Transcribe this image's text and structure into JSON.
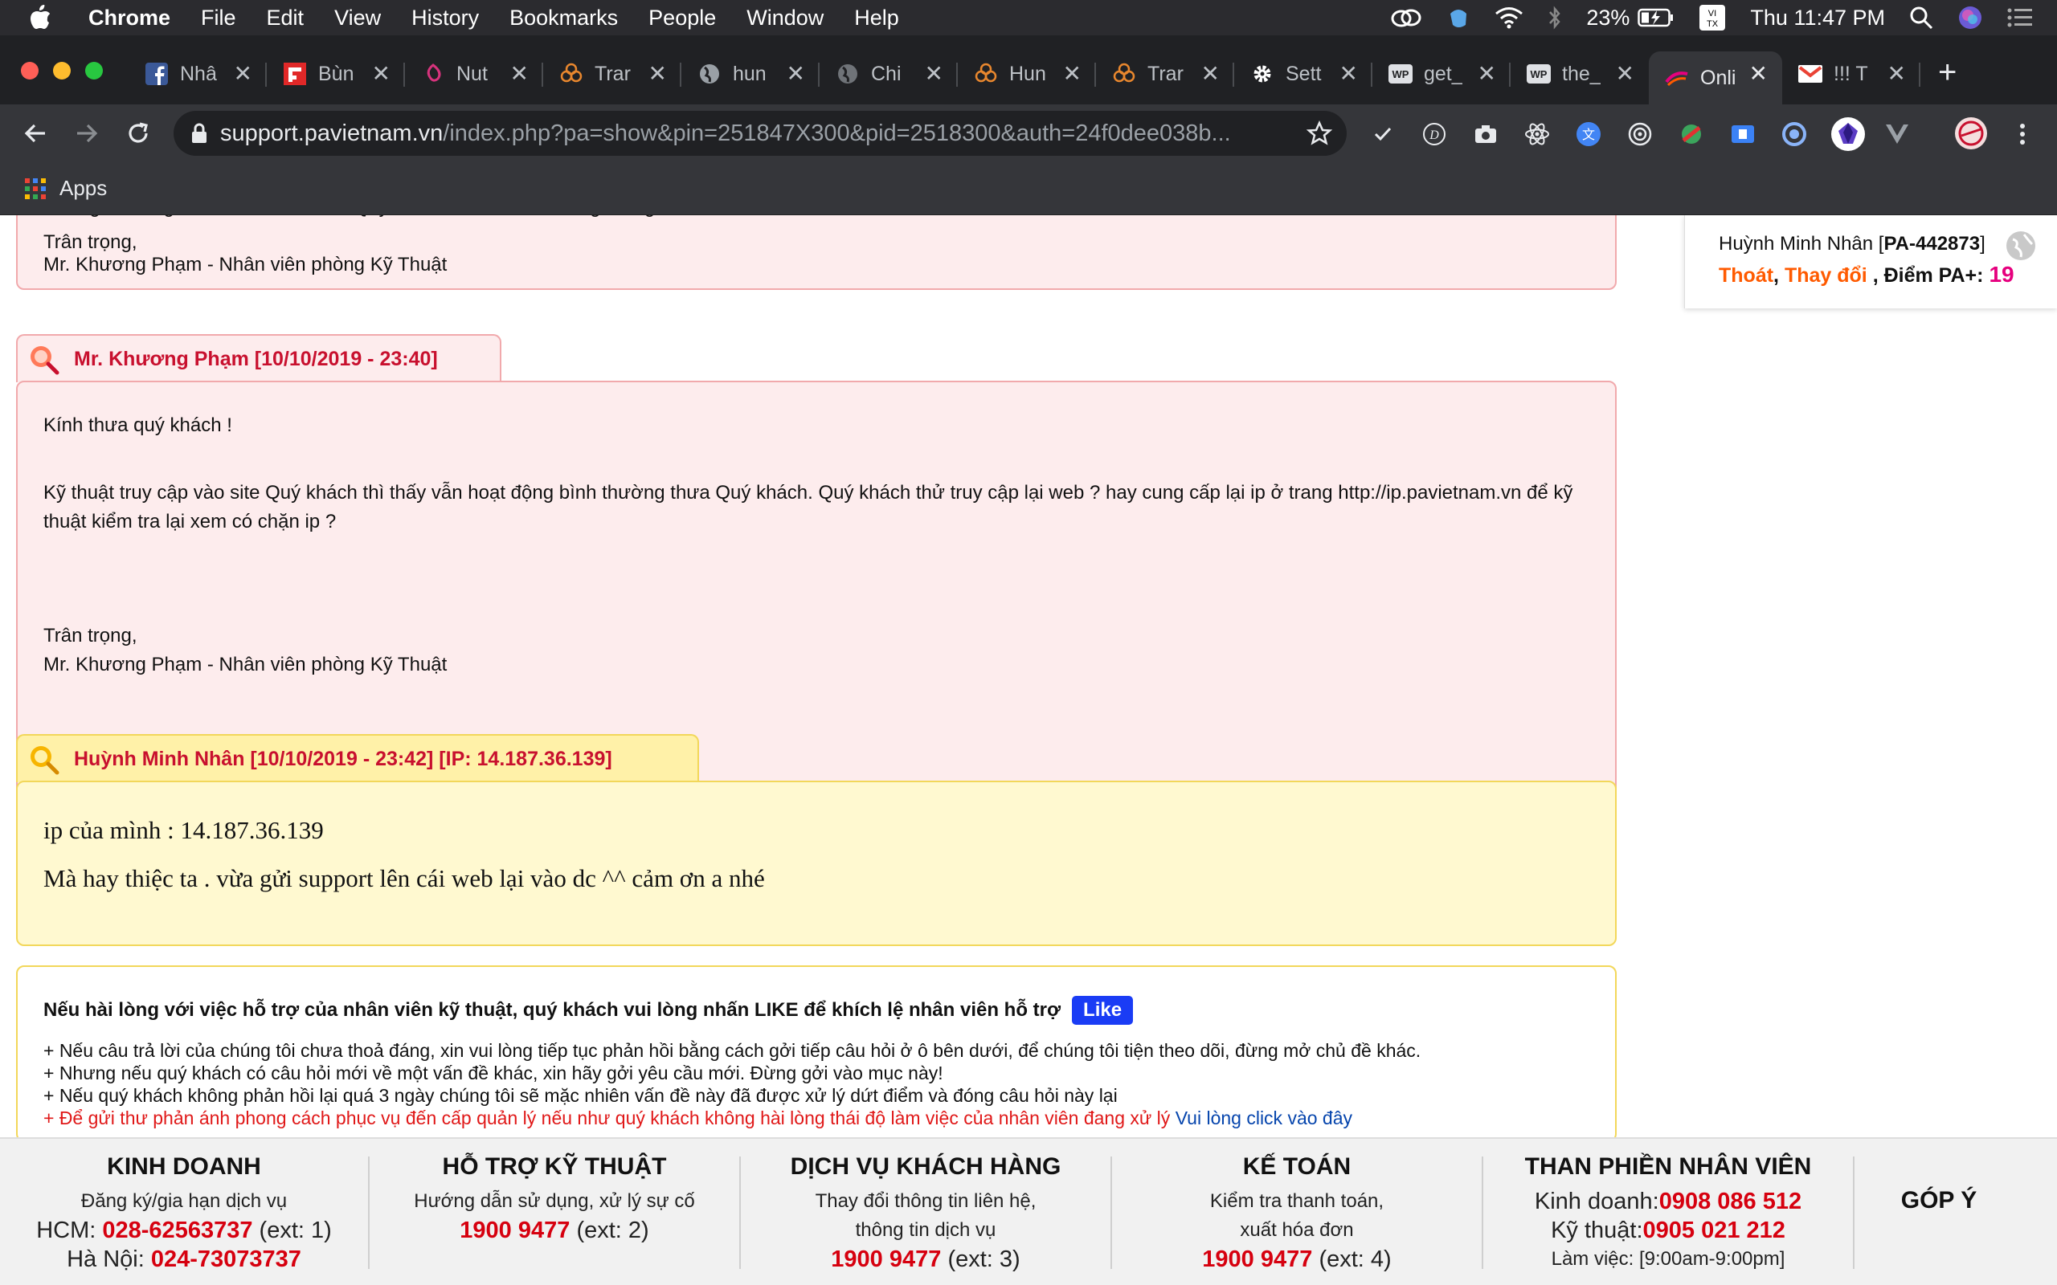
{
  "menubar": {
    "items": [
      "Chrome",
      "File",
      "Edit",
      "View",
      "History",
      "Bookmarks",
      "People",
      "Window",
      "Help"
    ],
    "battery": "23%",
    "clock": "Thu 11:47 PM"
  },
  "tabs": [
    {
      "title": "Nhâ",
      "icon": "facebook-icon"
    },
    {
      "title": "Bùn",
      "icon": "flipboard-icon"
    },
    {
      "title": "Nut",
      "icon": "nutrition-icon"
    },
    {
      "title": "Trar",
      "icon": "flower-icon"
    },
    {
      "title": "hun",
      "icon": "globe-icon"
    },
    {
      "title": "Chi",
      "icon": "globe-icon"
    },
    {
      "title": "Hun",
      "icon": "flower-icon"
    },
    {
      "title": "Trar",
      "icon": "flower-icon"
    },
    {
      "title": "Sett",
      "icon": "gear-icon"
    },
    {
      "title": "get_",
      "icon": "wp-icon"
    },
    {
      "title": "the_",
      "icon": "wp-icon"
    },
    {
      "title": "Onli",
      "icon": "pavietnam-icon"
    },
    {
      "title": "!!! T",
      "icon": "gmail-icon"
    }
  ],
  "omnibox": {
    "host": "support.pavietnam.vn",
    "path": "/index.php?pa=show&pin=251847X300&pid=2518300&auth=24f0dee038b..."
  },
  "bookmarks": {
    "apps_label": "Apps"
  },
  "user_box": {
    "name": "Huỳnh Minh Nhân",
    "code": "PA-442873",
    "logout": "Thoát",
    "change": "Thay đổi",
    "points_label": "Điểm PA+:",
    "points": "19"
  },
  "post0": {
    "partial_line": "Chúng tôi đang tìm hiểu vấn đề của Quý khách và sẽ trả lời trong thời gian sớm nhất",
    "regards": "Trân trọng,",
    "signature": "Mr. Khương Phạm - Nhân viên phòng Kỹ Thuật"
  },
  "post1": {
    "header": "Mr. Khương Phạm [10/10/2019 - 23:40]",
    "greeting": "Kính thưa quý khách !",
    "body_line1": "Kỹ thuật truy cập vào site Quý khách thì thấy vẫn hoạt động bình thường thưa Quý khách. Quý khách thử truy cập lại web ? hay cung cấp lại ip ở trang http://ip.pavietnam.vn để kỹ",
    "body_line2": "thuật kiểm tra lại xem có chặn ip ?",
    "regards": "Trân trọng,",
    "signature": "Mr. Khương Phạm - Nhân viên phòng Kỹ Thuật"
  },
  "post2": {
    "header": "Huỳnh Minh Nhân [10/10/2019 - 23:42] [IP: 14.187.36.139]",
    "line1": "ip của mình : 14.187.36.139",
    "line2": "Mà hay thiệc ta . vừa gửi support lên cái web lại vào dc ^^ cảm ơn a nhé"
  },
  "info": {
    "like_prompt": "Nếu hài lòng với việc hỗ trợ của nhân viên kỹ thuật, quý khách vui lòng nhấn LIKE để khích lệ nhân viên hỗ trợ",
    "like_button": "Like",
    "line1": "+ Nếu câu trả lời của chúng tôi chưa thoả đáng, xin vui lòng tiếp tục phản hồi bằng cách gởi tiếp câu hỏi ở ô bên dưới, để chúng tôi tiện theo dõi, đừng mở chủ đề khác.",
    "line2": "+ Nhưng nếu quý khách có câu hỏi mới về một vấn đề khác, xin hãy gởi yêu cầu mới. Đừng gởi vào mục này!",
    "line3": "+ Nếu quý khách không phản hồi lại quá 3 ngày chúng tôi sẽ mặc nhiên vấn đề này đã được xử lý dứt điểm và đóng câu hỏi này lại",
    "line4_red": "+ Để gửi thư phản ánh phong cách phục vụ đến cấp quản lý nếu như quý khách không hài lòng thái độ làm việc của nhân viên đang xử lý",
    "line4_link": "Vui lòng click vào đây"
  },
  "footer": {
    "sales": {
      "title": "KINH DOANH",
      "sub": "Đăng ký/gia hạn dịch vụ",
      "hcm_label": "HCM:",
      "hcm_phone": "028-62563737",
      "hcm_ext": "(ext: 1)",
      "hn_label": "Hà Nội:",
      "hn_phone": "024-73073737"
    },
    "tech": {
      "title": "HỖ TRỢ KỸ THUẬT",
      "sub": "Hướng dẫn sử dụng, xử lý sự cố",
      "phone": "1900 9477",
      "ext": "(ext: 2)"
    },
    "cs": {
      "title": "DỊCH VỤ KHÁCH HÀNG",
      "sub1": "Thay đổi thông tin liên hệ,",
      "sub2": "thông tin dịch vụ",
      "phone": "1900 9477",
      "ext": "(ext: 3)"
    },
    "acct": {
      "title": "KẾ TOÁN",
      "sub1": "Kiểm tra thanh toán,",
      "sub2": "xuất hóa đơn",
      "phone": "1900 9477",
      "ext": "(ext: 4)"
    },
    "complaint": {
      "title": "THAN PHIỀN NHÂN VIÊN",
      "sales_label": "Kinh doanh:",
      "sales_phone": "0908 086 512",
      "tech_label": "Kỹ thuật:",
      "tech_phone": "0905 021 212",
      "hours": "Làm việc: [9:00am-9:00pm]"
    },
    "feedback": "GÓP Ý"
  },
  "colors": {
    "accent_red": "#d6000f",
    "points_pink": "#e6007e",
    "orange": "#ff5a00",
    "link_blue": "#0645ad",
    "like_blue": "#1a3cf5"
  }
}
